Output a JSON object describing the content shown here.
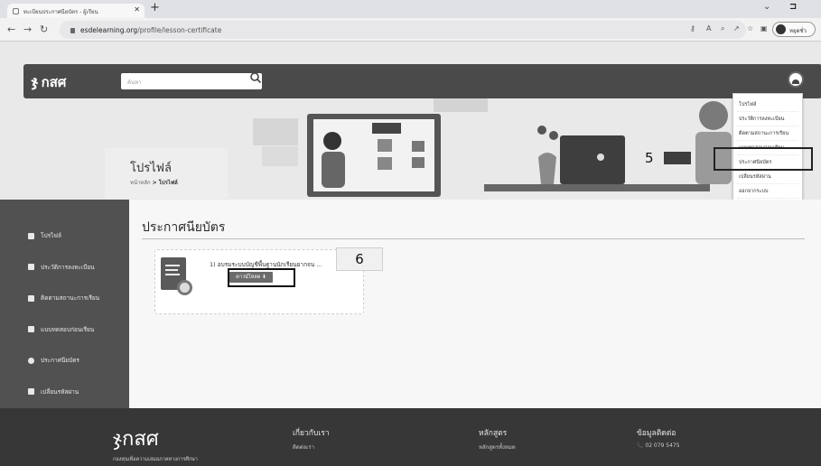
{
  "browser": {
    "tab_title": "ทะเบียนประกาศนียบัตร - ผู้เรียน",
    "tab_close": "✕",
    "new_tab": "+",
    "url_host": "esdelearning.org",
    "url_path": "/profile/lesson-certificate",
    "profile_label": "หยุดชั่ว",
    "toolbar_icons": [
      "key-icon",
      "translate-icon",
      "zoom-icon",
      "share-icon",
      "star-icon",
      "sidepanel-icon"
    ]
  },
  "header": {
    "logo_text": "กสศ",
    "search_placeholder": "ค้นหา"
  },
  "user_menu": {
    "items": [
      "โปรไฟล์",
      "ประวัติการลงทะเบียน",
      "ติดตามสถานะการเรียน",
      "แบบทดสอบก่อนเรียน",
      "ประกาศนียบัตร",
      "เปลี่ยนรหัสผ่าน",
      "ออกจากระบบ"
    ]
  },
  "hero": {
    "title": "โปรไฟล์",
    "breadcrumb_home": "หน้าหลัก",
    "breadcrumb_sep": ">",
    "breadcrumb_current": "โปรไฟล์"
  },
  "annotations": {
    "step5": "5",
    "step6": "6"
  },
  "sidebar": {
    "items": [
      {
        "label": "โปรไฟล์",
        "icon": "user-icon"
      },
      {
        "label": "ประวัติการลงทะเบียน",
        "icon": "book-icon"
      },
      {
        "label": "ติดตามสถานะการเรียน",
        "icon": "bookmark-icon"
      },
      {
        "label": "แบบทดสอบก่อนเรียน",
        "icon": "clipboard-icon"
      },
      {
        "label": "ประกาศนียบัตร",
        "icon": "medal-icon"
      },
      {
        "label": "เปลี่ยนรหัสผ่าน",
        "icon": "key-icon"
      }
    ]
  },
  "main": {
    "section_title": "ประกาศนียบัตร",
    "certificate": {
      "name": "1) อบรมระบบบัญชีพื้นฐานนักเรียนยากจน ...",
      "download_label": "ดาวน์โหลด ⬇"
    }
  },
  "footer": {
    "logo_text": "กสศ",
    "tagline": "กองทุนเพื่อความเสมอภาคทางการศึกษา",
    "about_heading": "เกี่ยวกับเรา",
    "about_link": "ติดต่อเรา",
    "courses_heading": "หลักสูตร",
    "courses_link": "หลักสูตรทั้งหมด",
    "contact_heading": "ข้อมูลติดต่อ",
    "phone": "📞 02 079 5475"
  },
  "colors": {
    "header_bg": "#4a4a4a",
    "sidebar_bg": "#515151",
    "footer_bg": "#373737",
    "highlight_border": "#222222"
  }
}
